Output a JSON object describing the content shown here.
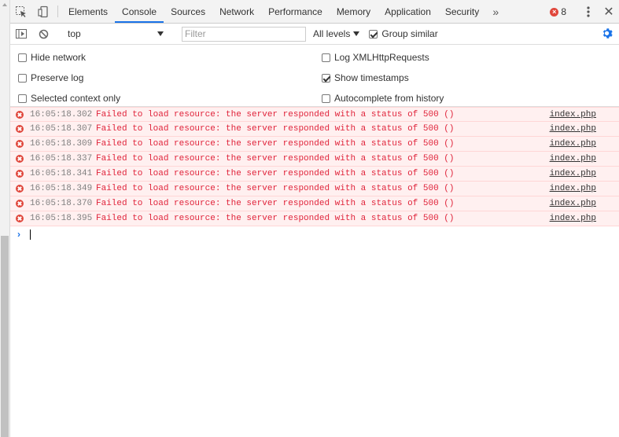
{
  "tabs": [
    "Elements",
    "Console",
    "Sources",
    "Network",
    "Performance",
    "Memory",
    "Application",
    "Security"
  ],
  "active_tab": "Console",
  "more_tabs_glyph": "»",
  "error_count": "8",
  "error_badge_glyph": "×",
  "close_glyph": "✕",
  "toolbar": {
    "context": "top",
    "filter_placeholder": "Filter",
    "levels_label": "All levels",
    "group_similar_label": "Group similar",
    "group_similar_checked": true
  },
  "settings": {
    "hide_network": "Hide network",
    "preserve_log": "Preserve log",
    "selected_context_only": "Selected context only",
    "log_xhr": "Log XMLHttpRequests",
    "show_timestamps": "Show timestamps",
    "autocomplete_history": "Autocomplete from history"
  },
  "messages": [
    {
      "time": "16:05:18.302",
      "text": "Failed to load resource: the server responded with a status of 500 ()",
      "source": "index.php"
    },
    {
      "time": "16:05:18.307",
      "text": "Failed to load resource: the server responded with a status of 500 ()",
      "source": "index.php"
    },
    {
      "time": "16:05:18.309",
      "text": "Failed to load resource: the server responded with a status of 500 ()",
      "source": "index.php"
    },
    {
      "time": "16:05:18.337",
      "text": "Failed to load resource: the server responded with a status of 500 ()",
      "source": "index.php"
    },
    {
      "time": "16:05:18.341",
      "text": "Failed to load resource: the server responded with a status of 500 ()",
      "source": "index.php"
    },
    {
      "time": "16:05:18.349",
      "text": "Failed to load resource: the server responded with a status of 500 ()",
      "source": "index.php"
    },
    {
      "time": "16:05:18.370",
      "text": "Failed to load resource: the server responded with a status of 500 ()",
      "source": "index.php"
    },
    {
      "time": "16:05:18.395",
      "text": "Failed to load resource: the server responded with a status of 500 ()",
      "source": "index.php"
    }
  ],
  "prompt_glyph": "›",
  "colors": {
    "accent": "#1a73e8",
    "error": "#e0463b",
    "error_text": "#e0243b",
    "error_row_bg": "#fff0f0"
  }
}
